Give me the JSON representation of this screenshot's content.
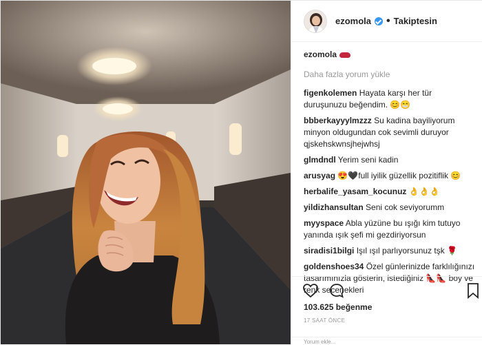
{
  "header": {
    "username": "ezomola",
    "follow_status": "Takiptesin",
    "separator": "•"
  },
  "caption": {
    "username": "ezomola"
  },
  "load_more": "Daha fazla yorum yükle",
  "comments": [
    {
      "user": "figenkolemen",
      "text": "Hayata karşı her tür duruşunuzu beğendim. 😊😁"
    },
    {
      "user": "bbberkayyylmzzz",
      "text": "Su kadina bayiliyorum minyon oldugundan cok sevimli duruyor qjskehskwnsjhejwhsj"
    },
    {
      "user": "glmdndl",
      "text": "Yerim seni kadin"
    },
    {
      "user": "arusyag",
      "text": "😍🖤full iyilik güzellik pozitiflik 😊"
    },
    {
      "user": "herbalife_yasam_kocunuz",
      "text": "👌👌👌"
    },
    {
      "user": "yildizhansultan",
      "text": "Seni cok seviyorumm"
    },
    {
      "user": "myyspace",
      "text": "Abla yüzüne bu ışığı kim tutuyo yanında ışık şefi mi gezdiriyorsun"
    },
    {
      "user": "siradisi1bilgi",
      "text": "Işıl ışıl parlıyorsunuz tşk 🌹"
    },
    {
      "user": "goldenshoes34",
      "text": "Özel günlerinizde farklılığınızı tasarımınızla gösterin, istediğiniz 👠👠 boy ve renk secenekleri"
    }
  ],
  "likes": "103.625 beğenme",
  "timestamp": "17 SAAT ÖNCE",
  "add_comment_placeholder": "Yorum ekle...",
  "colors": {
    "verified": "#3897f0",
    "muted": "#999999"
  }
}
